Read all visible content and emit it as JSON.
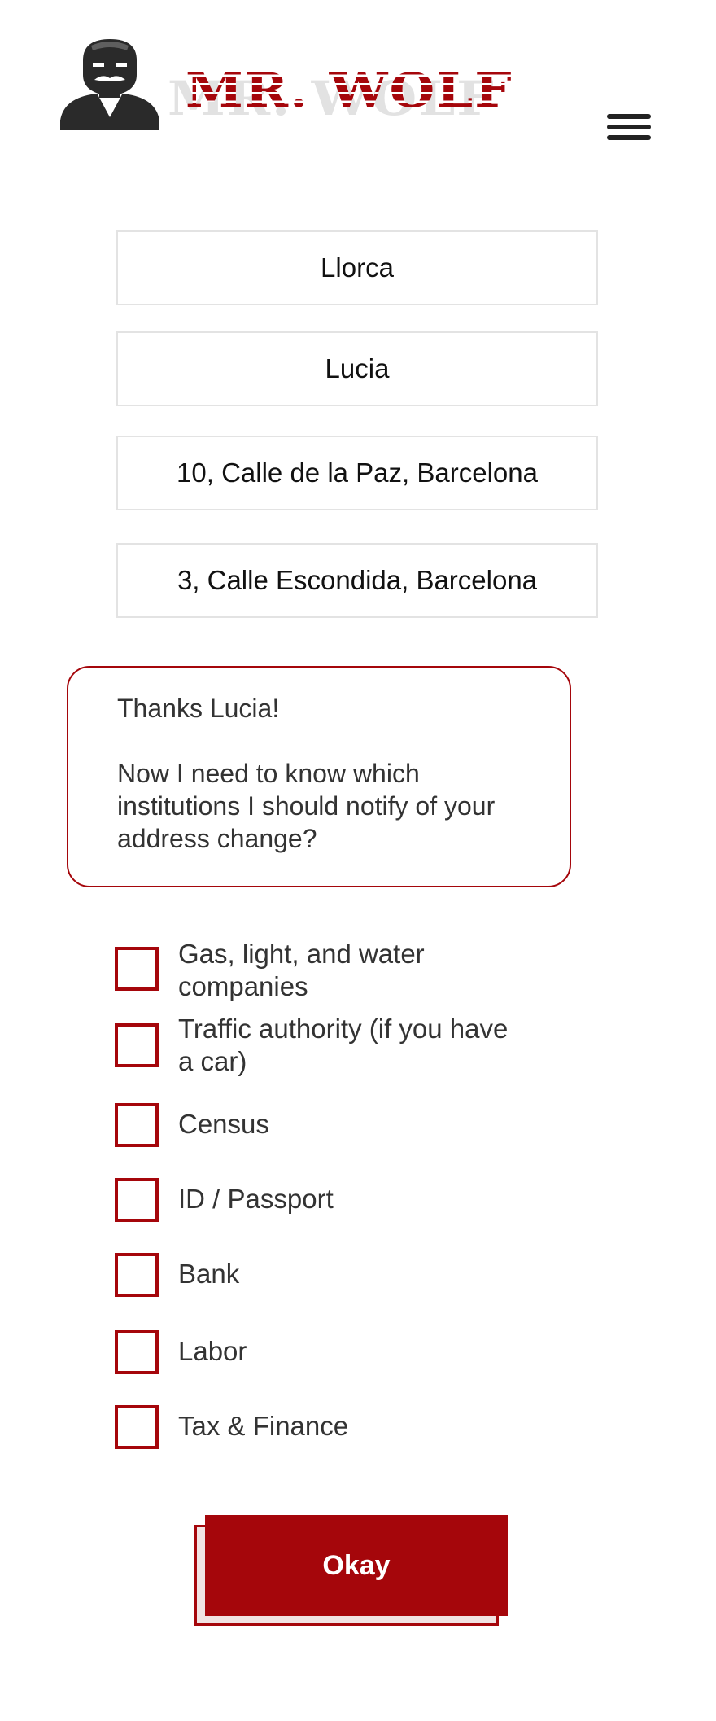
{
  "header": {
    "brand_name": "MR. WOLF",
    "logo_icon": "wolf-mascot-icon",
    "menu_icon": "hamburger-menu-icon"
  },
  "form": {
    "fields": [
      {
        "value": "Llorca"
      },
      {
        "value": "Lucia"
      },
      {
        "value": "10, Calle de la Paz, Barcelona"
      },
      {
        "value": "3, Calle Escondida, Barcelona"
      }
    ]
  },
  "message": {
    "greeting": "Thanks Lucia!",
    "body": "Now I need to know which institutions I should notify of your address change?"
  },
  "institutions": [
    {
      "label": "Gas, light, and water companies",
      "checked": false
    },
    {
      "label": "Traffic authority (if you have a car)",
      "checked": false
    },
    {
      "label": "Census",
      "checked": false
    },
    {
      "label": "ID / Passport",
      "checked": false
    },
    {
      "label": "Bank",
      "checked": false
    },
    {
      "label": "Labor",
      "checked": false
    },
    {
      "label": "Tax & Finance",
      "checked": false
    }
  ],
  "actions": {
    "okay_label": "Okay"
  },
  "colors": {
    "accent": "#a5060b",
    "text": "#333333",
    "field_border": "#e3e3e3"
  }
}
